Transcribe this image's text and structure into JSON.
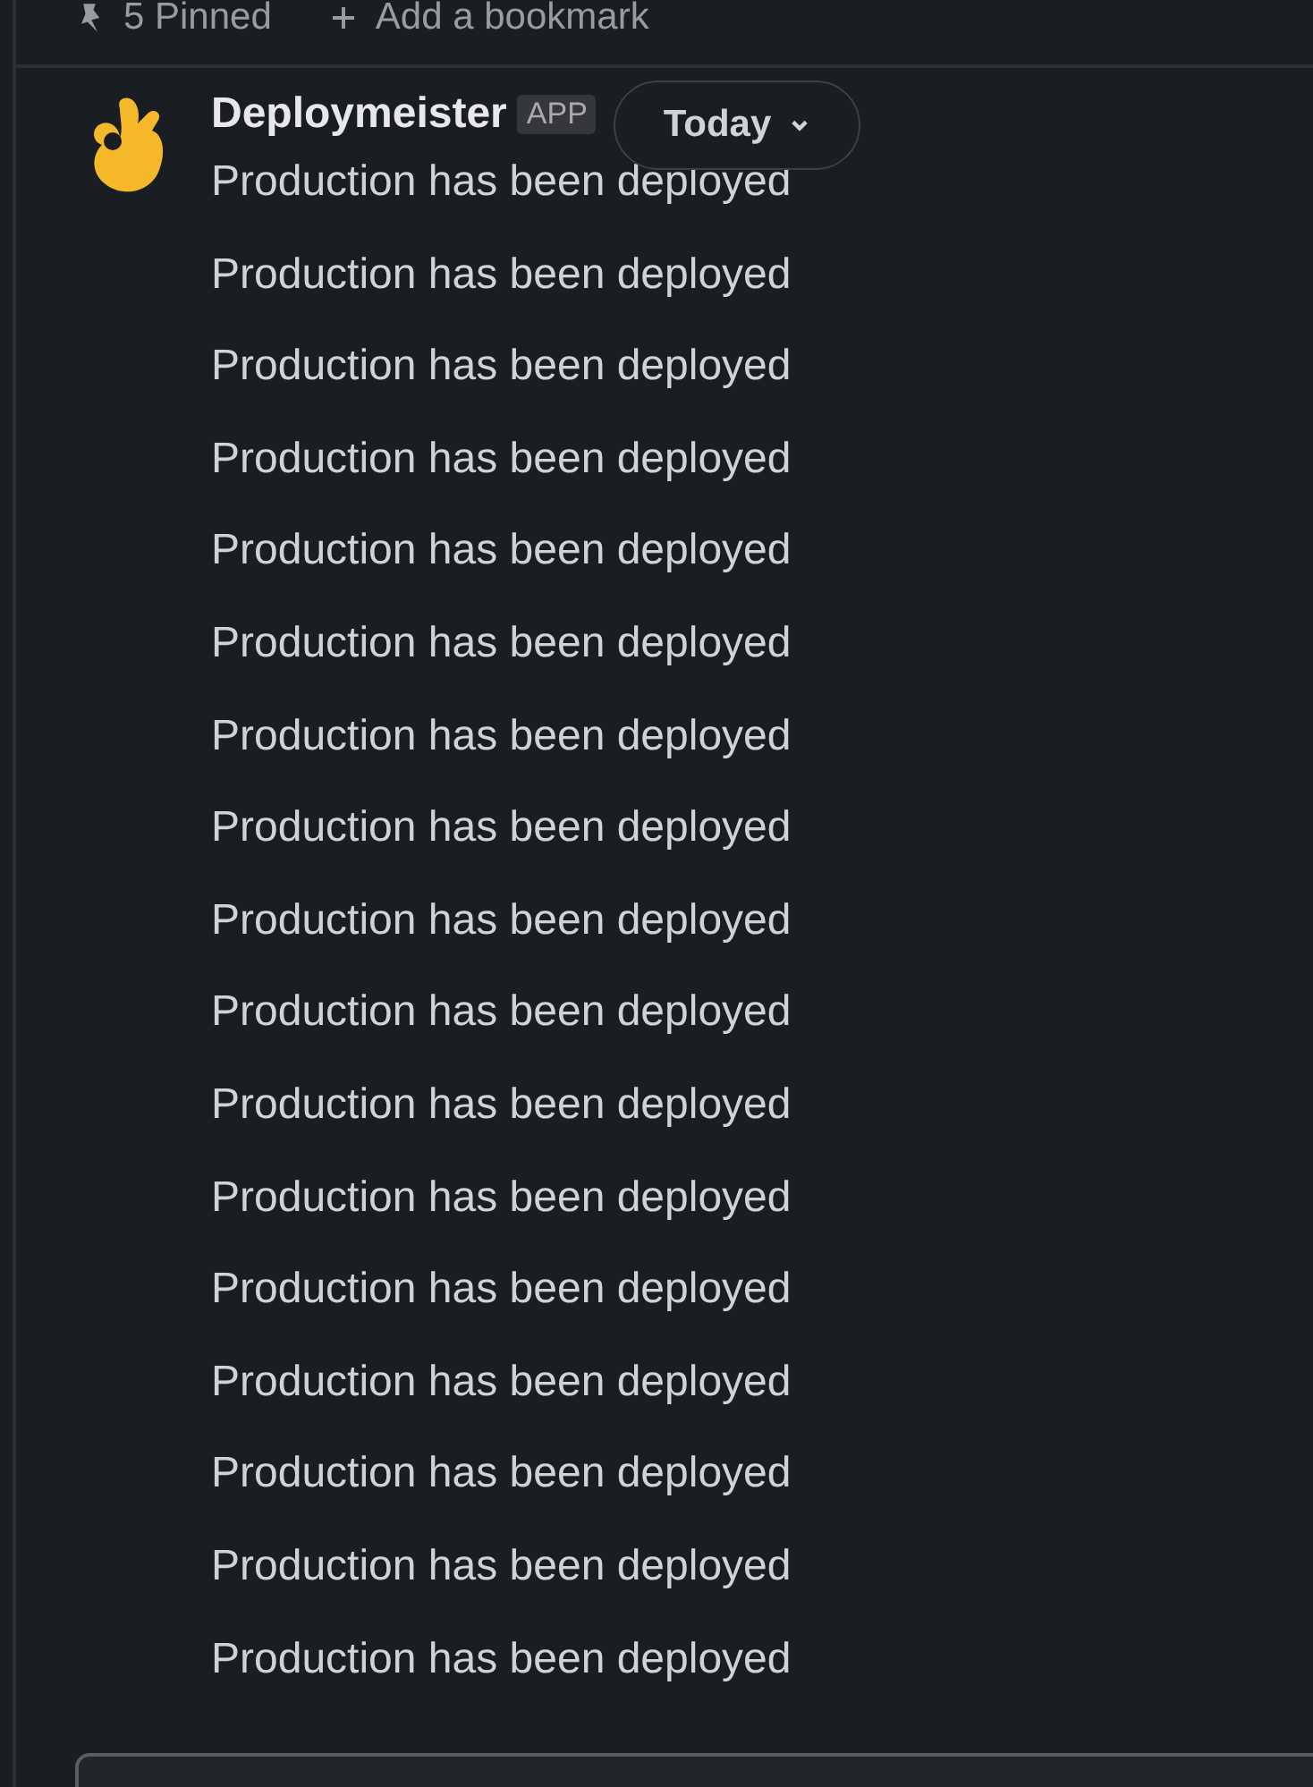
{
  "bookmarks_bar": {
    "pinned": "5 Pinned",
    "add_bookmark": "Add a bookmark"
  },
  "message_group": {
    "sender": "Deploymeister",
    "badge": "APP",
    "date_divider": "Today",
    "messages": [
      "Production has been deployed",
      "Production has been deployed",
      "Production has been deployed",
      "Production has been deployed",
      "Production has been deployed",
      "Production has been deployed",
      "Production has been deployed",
      "Production has been deployed",
      "Production has been deployed",
      "Production has been deployed",
      "Production has been deployed",
      "Production has been deployed",
      "Production has been deployed",
      "Production has been deployed",
      "Production has been deployed",
      "Production has been deployed",
      "Production has been deployed"
    ]
  }
}
